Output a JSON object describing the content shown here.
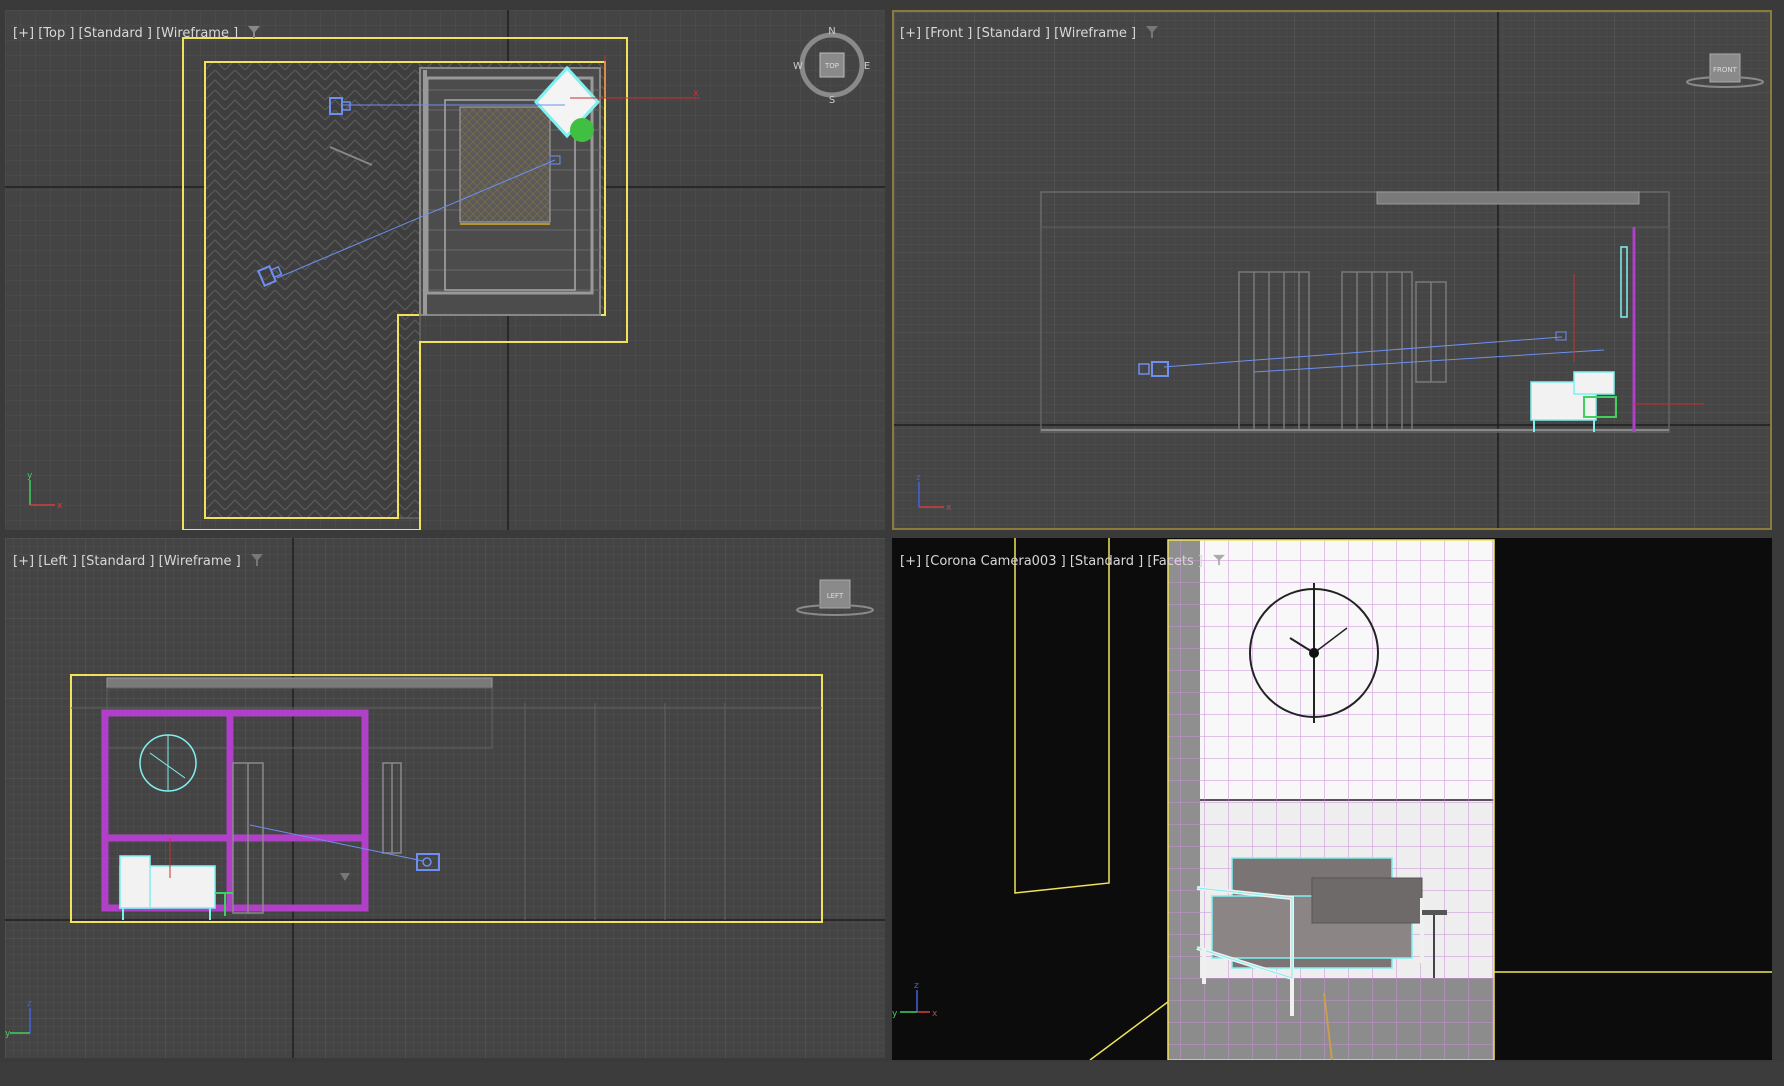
{
  "viewports": {
    "top": {
      "labels": [
        "[+]",
        "[Top ]",
        "[Standard ]",
        "[Wireframe ]"
      ],
      "viewcube": {
        "face": "TOP",
        "north": "N",
        "south": "S",
        "east": "E",
        "west": "W"
      },
      "axis": {
        "x": "x",
        "y": "y"
      }
    },
    "front": {
      "labels": [
        "[+]",
        "[Front ]",
        "[Standard ]",
        "[Wireframe ]"
      ],
      "viewcube": {
        "face": "FRONT"
      },
      "axis": {
        "x": "x",
        "z": "z"
      }
    },
    "left": {
      "labels": [
        "[+]",
        "[Left ]",
        "[Standard ]",
        "[Wireframe ]"
      ],
      "viewcube": {
        "face": "LEFT"
      },
      "axis": {
        "y": "y",
        "z": "z"
      }
    },
    "camera": {
      "labels": [
        "[+]",
        "[Corona Camera003 ]",
        "[Standard ]",
        "[Facets ]"
      ],
      "axis": {
        "y": "y",
        "z": "z",
        "x": "x"
      }
    }
  },
  "colors": {
    "grid_bg": "#444444",
    "grid_line": "#505050",
    "axis_line": "#1e1e1e",
    "selection_yellow": "#f0e35a",
    "camera_blue": "#6d8ff0",
    "light_cyan": "#7ff0f0",
    "purple": "#b040c8",
    "green": "#40d060",
    "active_border": "#8b7b3a"
  }
}
